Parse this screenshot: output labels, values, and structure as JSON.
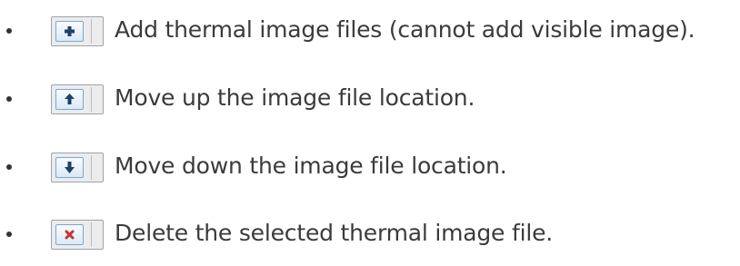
{
  "items": [
    {
      "icon": "plus-icon",
      "text": "Add thermal image files (cannot add visible image)."
    },
    {
      "icon": "arrow-up-icon",
      "text": "Move up the image file location."
    },
    {
      "icon": "arrow-down-icon",
      "text": "Move down the image file location."
    },
    {
      "icon": "delete-x-icon",
      "text": "Delete the selected thermal image file."
    }
  ],
  "colors": {
    "icon_dark": "#1f3f6b",
    "icon_delete": "#c0392b",
    "button_border": "#7aa7d4",
    "text": "#3b3b3b"
  }
}
